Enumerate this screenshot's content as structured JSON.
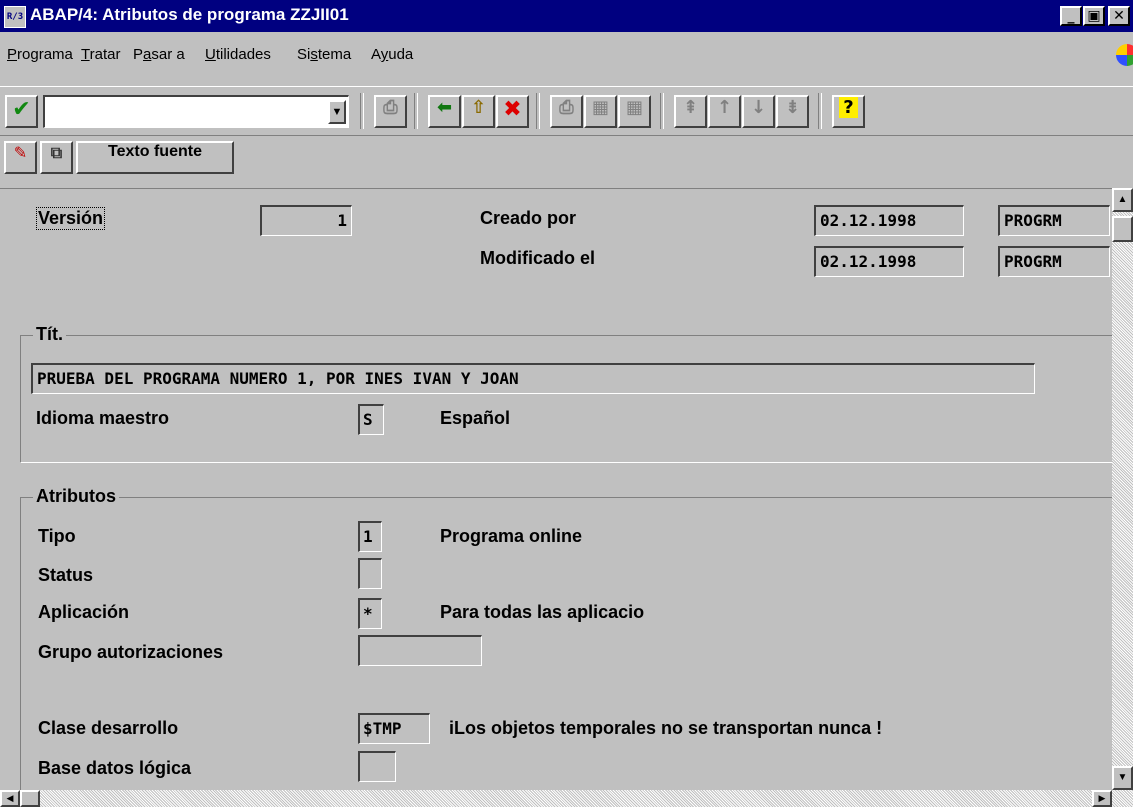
{
  "window": {
    "title": "ABAP/4: Atributos de programa ZZJII01",
    "app_icon": "sap-icon",
    "buttons": {
      "minimize": "_",
      "maximize": "▣",
      "close": "✕"
    }
  },
  "menu": [
    {
      "label": "Programa",
      "accel": "P"
    },
    {
      "label": "Tratar",
      "accel": "T"
    },
    {
      "label": "Pasar a",
      "accel": "a"
    },
    {
      "label": "Utilidades",
      "accel": "U"
    },
    {
      "label": "Sistema",
      "accel": "s"
    },
    {
      "label": "Ayuda",
      "accel": "y"
    }
  ],
  "toolbar": {
    "command_field_value": "",
    "icons": [
      "check-icon",
      "save-icon",
      "back-icon",
      "exit-icon",
      "cancel-icon",
      "print-icon",
      "find-icon",
      "find-next-icon",
      "first-page-icon",
      "prev-page-icon",
      "next-page-icon",
      "last-page-icon",
      "help-icon"
    ]
  },
  "app_toolbar": {
    "texto_fuente_label": "Texto fuente"
  },
  "header": {
    "version_label": "Versión",
    "version_value": "1",
    "creado_label": "Creado por",
    "creado_date": "02.12.1998",
    "creado_user": "PROGRM",
    "modificado_label": "Modificado el",
    "modificado_date": "02.12.1998",
    "modificado_user": "PROGRM"
  },
  "titulo": {
    "group_title": "Tít.",
    "title_value": "PRUEBA DEL PROGRAMA NUMERO 1, POR INES IVAN Y JOAN",
    "idioma_label": "Idioma maestro",
    "idioma_value": "S",
    "idioma_text": "Español"
  },
  "atributos": {
    "group_title": "Atributos",
    "tipo_label": "Tipo",
    "tipo_value": "1",
    "tipo_text": "Programa online",
    "status_label": "Status",
    "status_value": "",
    "aplicacion_label": "Aplicación",
    "aplicacion_value": "*",
    "aplicacion_text": "Para todas las aplicacio",
    "grupo_label": "Grupo autorizaciones",
    "grupo_value": "",
    "clase_label": "Clase desarrollo",
    "clase_value": "$TMP",
    "clase_text": "iLos objetos temporales no se transportan nunca !",
    "base_label": "Base datos lógica",
    "base_value": ""
  }
}
